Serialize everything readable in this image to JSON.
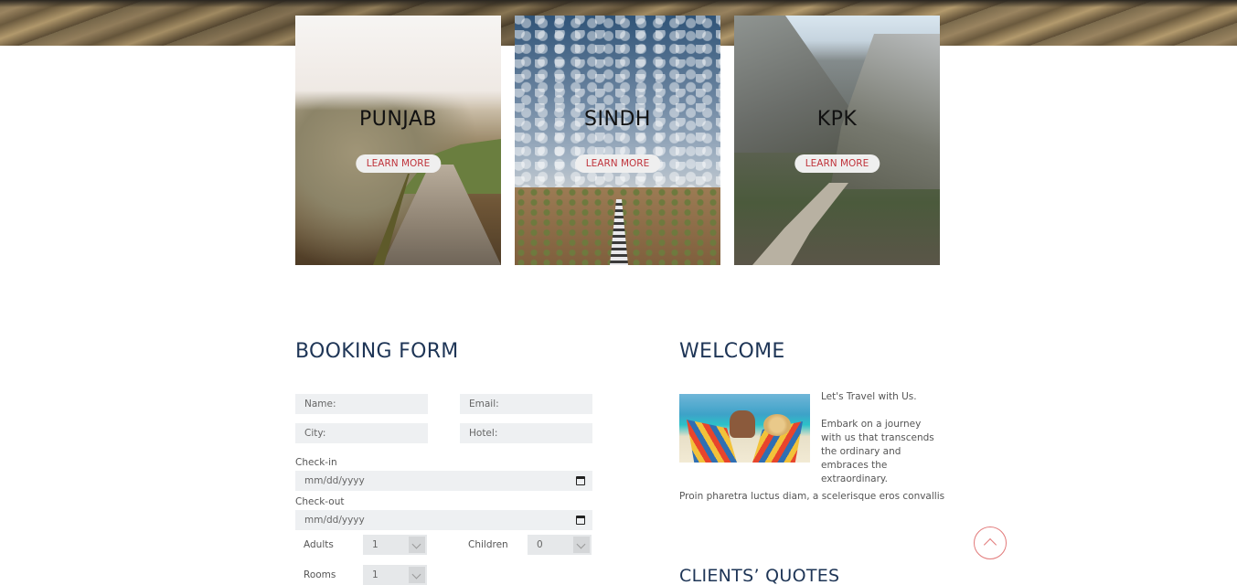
{
  "destinations": [
    {
      "title": "PUNJAB",
      "button": "LEARN MORE"
    },
    {
      "title": "SINDH",
      "button": "LEARN MORE"
    },
    {
      "title": "KPK",
      "button": "LEARN MORE"
    }
  ],
  "booking": {
    "title": "BOOKING FORM",
    "name_placeholder": "Name:",
    "email_placeholder": "Email:",
    "city_placeholder": "City:",
    "hotel_placeholder": "Hotel:",
    "checkin_label": "Check-in",
    "checkin_value": "mm/dd/yyyy",
    "checkout_label": "Check-out",
    "checkout_value": "mm/dd/yyyy",
    "adults_label": "Adults",
    "adults_value": "1",
    "children_label": "Children",
    "children_value": "0",
    "rooms_label": "Rooms",
    "rooms_value": "1"
  },
  "welcome": {
    "title": "WELCOME",
    "tagline": "Let's Travel with Us.",
    "body": "Embark on a journey with us that transcends the ordinary and embraces the extraordinary.",
    "extra": "Proin pharetra luctus diam, a scelerisque eros convallis"
  },
  "quotes": {
    "title": "CLIENTS’ QUOTES"
  },
  "colors": {
    "heading": "#1e3556",
    "button_text": "#c0343c",
    "scroll_top": "#e27a7a"
  },
  "icons": {
    "scroll_top": "chevron-up-icon",
    "calendar": "calendar-icon"
  }
}
